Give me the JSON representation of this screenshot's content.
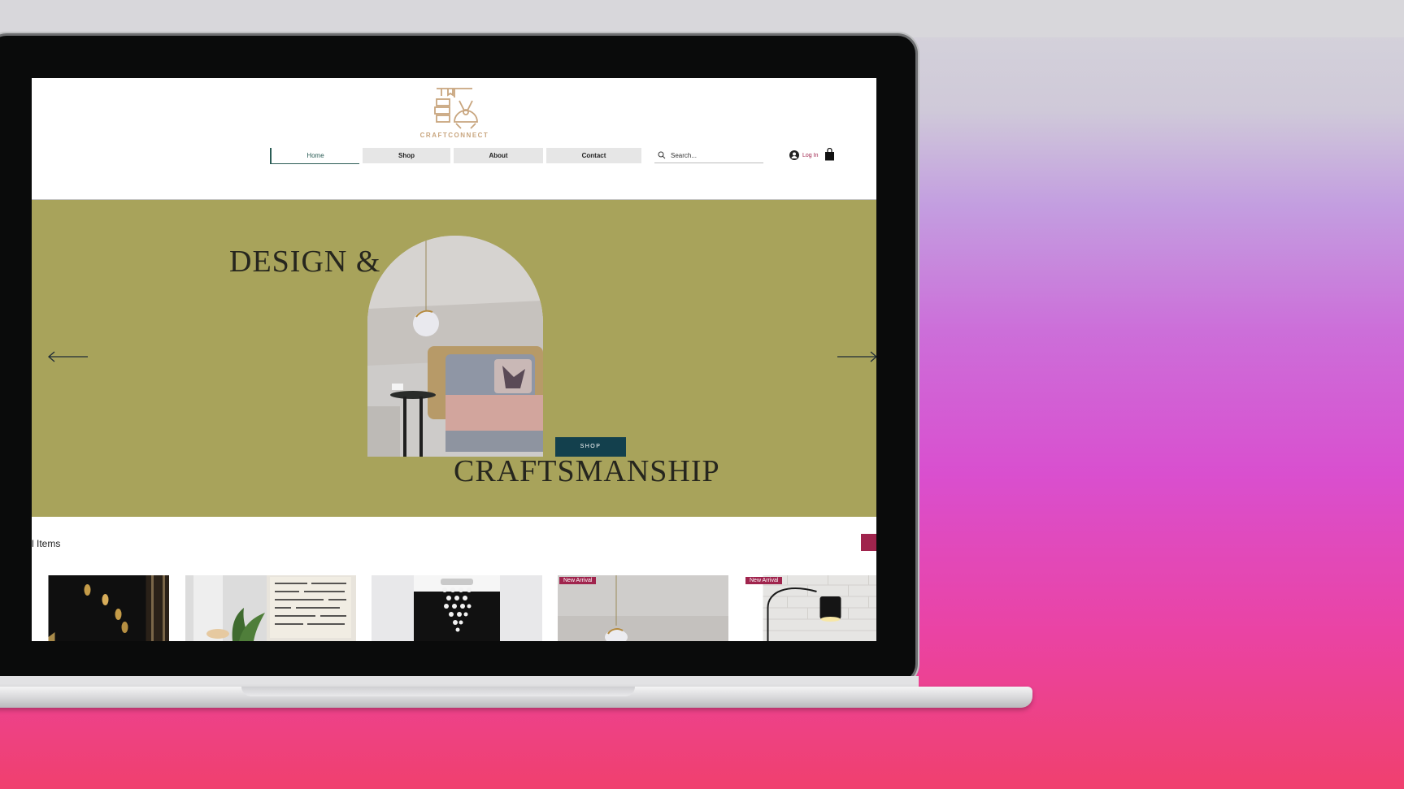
{
  "site": {
    "logo_text": "CRAFTCONNECT",
    "nav": [
      {
        "label": "Home",
        "active": true
      },
      {
        "label": "Shop",
        "active": false
      },
      {
        "label": "About",
        "active": false
      },
      {
        "label": "Contact",
        "active": false
      }
    ],
    "search": {
      "placeholder": "Search..."
    },
    "login_label": "Log In"
  },
  "hero": {
    "title_line_1": "DESIGN &",
    "title_line_2": "CRAFTSMANSHIP",
    "shop_button": "SHOP",
    "background_color": "#a8a35b",
    "button_color": "#13404d"
  },
  "products": {
    "items_label": "l Items",
    "cards": [
      {
        "badge": ""
      },
      {
        "badge": ""
      },
      {
        "badge": ""
      },
      {
        "badge": "New Arrival"
      },
      {
        "badge": "New Arrival"
      }
    ]
  },
  "colors": {
    "accent": "#a0244d",
    "logo": "#c8a57e"
  },
  "icons": [
    "search-icon",
    "avatar-icon",
    "cart-icon",
    "arrow-left-icon",
    "arrow-right-icon"
  ]
}
